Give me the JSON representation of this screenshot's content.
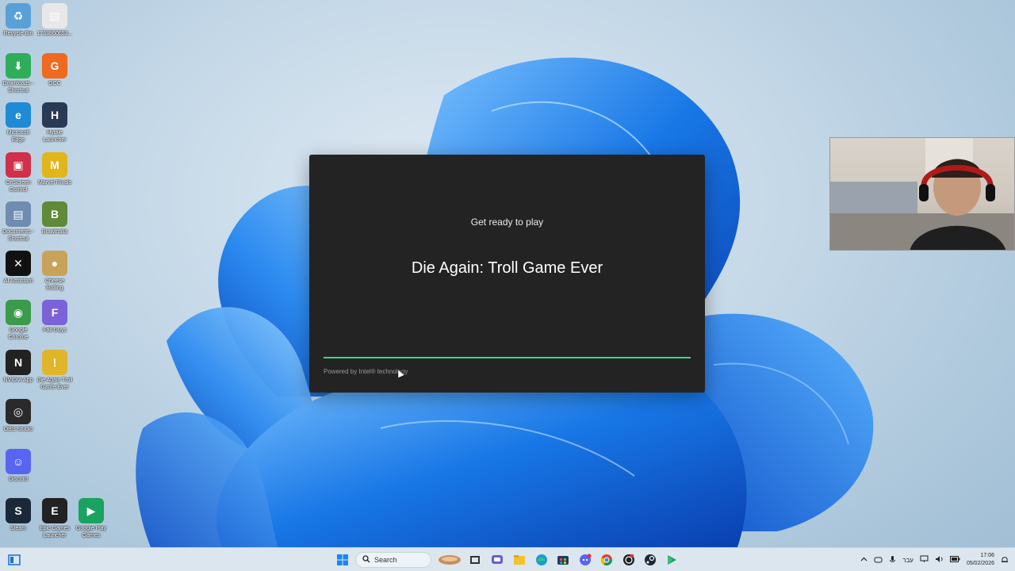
{
  "desktop": {
    "icons": [
      {
        "label": "Recycle Bin",
        "color": "#5aa0d8",
        "glyph": "♻"
      },
      {
        "label": "1768860653...",
        "color": "#e8e8e8",
        "glyph": "▤"
      },
      {
        "label": "Downloads - Shortcut",
        "color": "#2eae5a",
        "glyph": "⬇"
      },
      {
        "label": "GCC",
        "color": "#ef6a1f",
        "glyph": "G"
      },
      {
        "label": "Microsoft Edge",
        "color": "#1f8ad6",
        "glyph": "e"
      },
      {
        "label": "Hytale Launcher",
        "color": "#2a3a55",
        "glyph": "H"
      },
      {
        "label": "OnScreen Control",
        "color": "#d0304a",
        "glyph": "▣"
      },
      {
        "label": "Marvel Rivals",
        "color": "#e2b51a",
        "glyph": "M"
      },
      {
        "label": "Documents - Shortcut",
        "color": "#6f8db0",
        "glyph": "▤"
      },
      {
        "label": "Brawlhalla",
        "color": "#5f8a3a",
        "glyph": "B"
      },
      {
        "label": "AI Assistant",
        "color": "#111111",
        "glyph": "✕"
      },
      {
        "label": "Cheese Rolling",
        "color": "#c9a25a",
        "glyph": "●"
      },
      {
        "label": "Google Chrome",
        "color": "#3a9b4a",
        "glyph": "◉"
      },
      {
        "label": "Fall Guys",
        "color": "#7a63d8",
        "glyph": "F"
      },
      {
        "label": "NVIDIA App",
        "color": "#222222",
        "glyph": "N"
      },
      {
        "label": "Die Again Troll Game Ever",
        "color": "#e0b52a",
        "glyph": "!"
      },
      {
        "label": "OBS Studio",
        "color": "#2a2a2a",
        "glyph": "◎"
      },
      {
        "label": "Discord",
        "color": "#5865f2",
        "glyph": "☺"
      },
      {
        "label": "Steam",
        "color": "#1b2838",
        "glyph": "S"
      },
      {
        "label": "Epic Games Launcher",
        "color": "#222222",
        "glyph": "E"
      },
      {
        "label": "Google Play Games",
        "color": "#1aa260",
        "glyph": "▶"
      }
    ]
  },
  "modal": {
    "subtitle": "Get ready to play",
    "game_title": "Die Again: Troll Game Ever",
    "progress": 1.0,
    "progress_color": "#3ed67a",
    "powered_by": "Powered by Intel® technology"
  },
  "taskbar": {
    "search_label": "Search",
    "clock_time": "17:06",
    "clock_date": "05/02/2026",
    "language": "עבר",
    "apps": [
      "start-icon",
      "search-icon",
      "cheese-app-icon",
      "task-view-icon",
      "chat-icon",
      "file-explorer-icon",
      "edge-icon",
      "store-icon",
      "discord-icon",
      "chrome-icon",
      "obs-icon",
      "steam-icon",
      "google-play-games-icon"
    ]
  }
}
